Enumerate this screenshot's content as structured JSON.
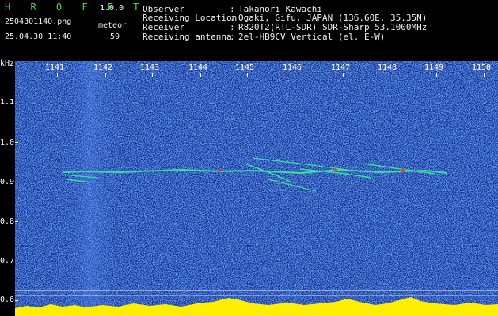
{
  "header": {
    "app_name": "H R O F F T",
    "version": "1.0.0",
    "filename": "2504301140.png",
    "mode": "meteor",
    "datetime": "25.04.30 11:40",
    "count": "59"
  },
  "meta": [
    {
      "label": "Observer",
      "value": "Takanori Kawachi"
    },
    {
      "label": "Receiving Location",
      "value": "Ogaki, Gifu, JAPAN (136.60E, 35.35N)"
    },
    {
      "label": "Receiver",
      "value": "R820T2(RTL-SDR) SDR-Sharp 53.1000MHz"
    },
    {
      "label": "Receiving antenna",
      "value": "2el-HB9CV Vertical (el. E-W)"
    }
  ],
  "axes": {
    "y_unit": "kHz",
    "y_ticks": [
      "1.1",
      "1.0",
      "0.9",
      "0.8",
      "0.7",
      "0.6"
    ],
    "x_ticks": [
      "1141",
      "1142",
      "1143",
      "1144",
      "1145",
      "1146",
      "1147",
      "1148",
      "1149",
      "1150"
    ]
  },
  "colors": {
    "background": "#0c1d87",
    "trace_green": "#36e0a0",
    "trace_red": "#ff3030",
    "noise_bar": "#ffee00",
    "brand_green": "#46d648"
  }
}
